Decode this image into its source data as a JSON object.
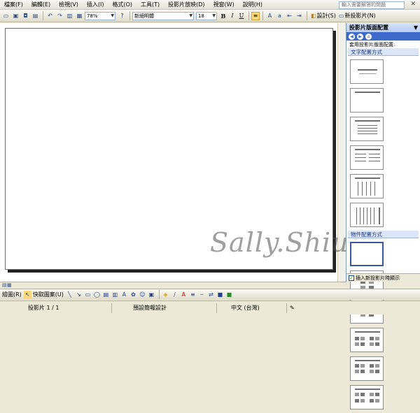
{
  "menu": {
    "items": [
      "檔案(F)",
      "編輯(E)",
      "檢視(V)",
      "插入(I)",
      "格式(O)",
      "工具(T)",
      "投影片放映(D)",
      "視窗(W)",
      "說明(H)"
    ],
    "help_placeholder": "輸入需要解答的問題",
    "close_icon": "close-icon"
  },
  "toolbar": {
    "zoom": "78%",
    "font_name": "新細明體",
    "font_size": "18",
    "bold": "B",
    "italic": "I",
    "underline": "U",
    "design_label": "設計(S)",
    "new_slide_label": "新投影片(N)"
  },
  "task_pane": {
    "title": "投影片版面配置",
    "subtitle": "套用投影片版面配置:",
    "text_layouts_heading": "文字配置方式",
    "content_layouts_heading": "物件配置方式",
    "show_on_insert_label": "插入新投影片時顯示"
  },
  "slide": {
    "watermark": "Sally.Shiuan"
  },
  "drawing_toolbar": {
    "draw_label": "繪圖(R)",
    "autoshapes_label": "快取圖案(U)"
  },
  "status_bar": {
    "slide_count": "投影片 1 / 1",
    "design": "預設簡報設計",
    "language": "中文 (台灣)"
  },
  "colors": {
    "accent": "#3e6acc",
    "selection": "#39579a",
    "section_text": "#15348c"
  }
}
